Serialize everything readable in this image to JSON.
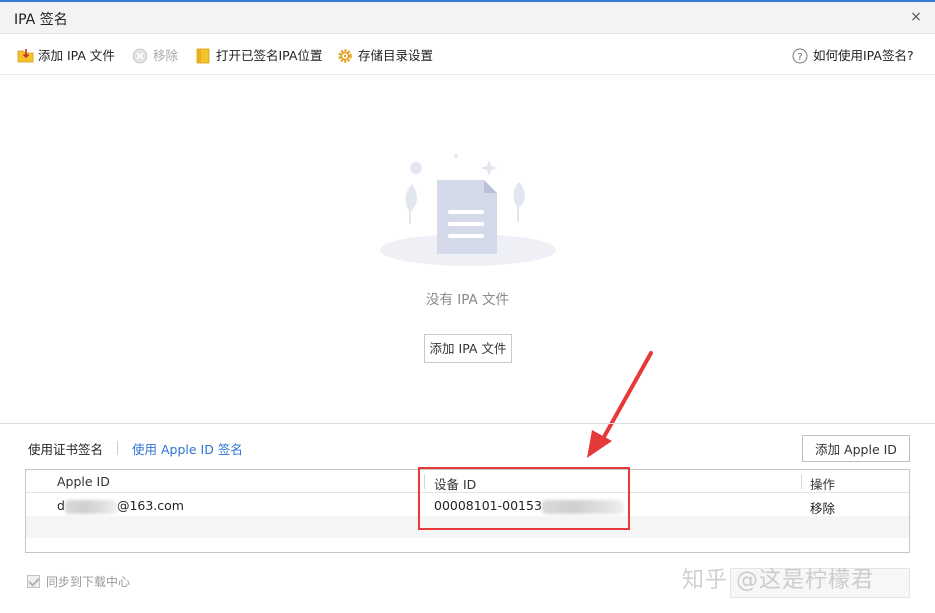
{
  "window": {
    "title": "IPA 签名",
    "close_glyph": "×"
  },
  "toolbar": {
    "add_ipa": {
      "label": "添加 IPA 文件",
      "icon": "folder-add-icon"
    },
    "remove": {
      "label": "移除",
      "icon": "remove-icon",
      "disabled": true
    },
    "open_signed_location": {
      "label": "打开已签名IPA位置",
      "icon": "folder-icon"
    },
    "storage_settings": {
      "label": "存储目录设置",
      "icon": "gear-icon"
    },
    "help": {
      "label": "如何使用IPA签名?",
      "icon": "question-icon"
    }
  },
  "empty_state": {
    "text": "没有 IPA 文件",
    "add_button_label": "添加 IPA 文件"
  },
  "sign_mode": {
    "tabs": [
      {
        "label": "使用证书签名",
        "active": true
      },
      {
        "label": "使用 Apple ID 签名",
        "active": false
      }
    ],
    "add_apple_id_label": "添加 Apple ID"
  },
  "table": {
    "columns": [
      "Apple ID",
      "设备 ID",
      "操作"
    ],
    "rows": [
      {
        "apple_id_prefix": "d",
        "apple_id_suffix": "@163.com",
        "device_id": "00008101-00153",
        "action": "移除"
      }
    ]
  },
  "footer": {
    "sync_label": "同步到下载中心",
    "sync_checked": true
  },
  "watermark": "知乎 @这是柠檬君",
  "colors": {
    "accent_blue": "#2e73d0",
    "highlight_red": "#e5393a",
    "folder_yellow": "#f4c22b",
    "gear_orange": "#e3a020"
  }
}
